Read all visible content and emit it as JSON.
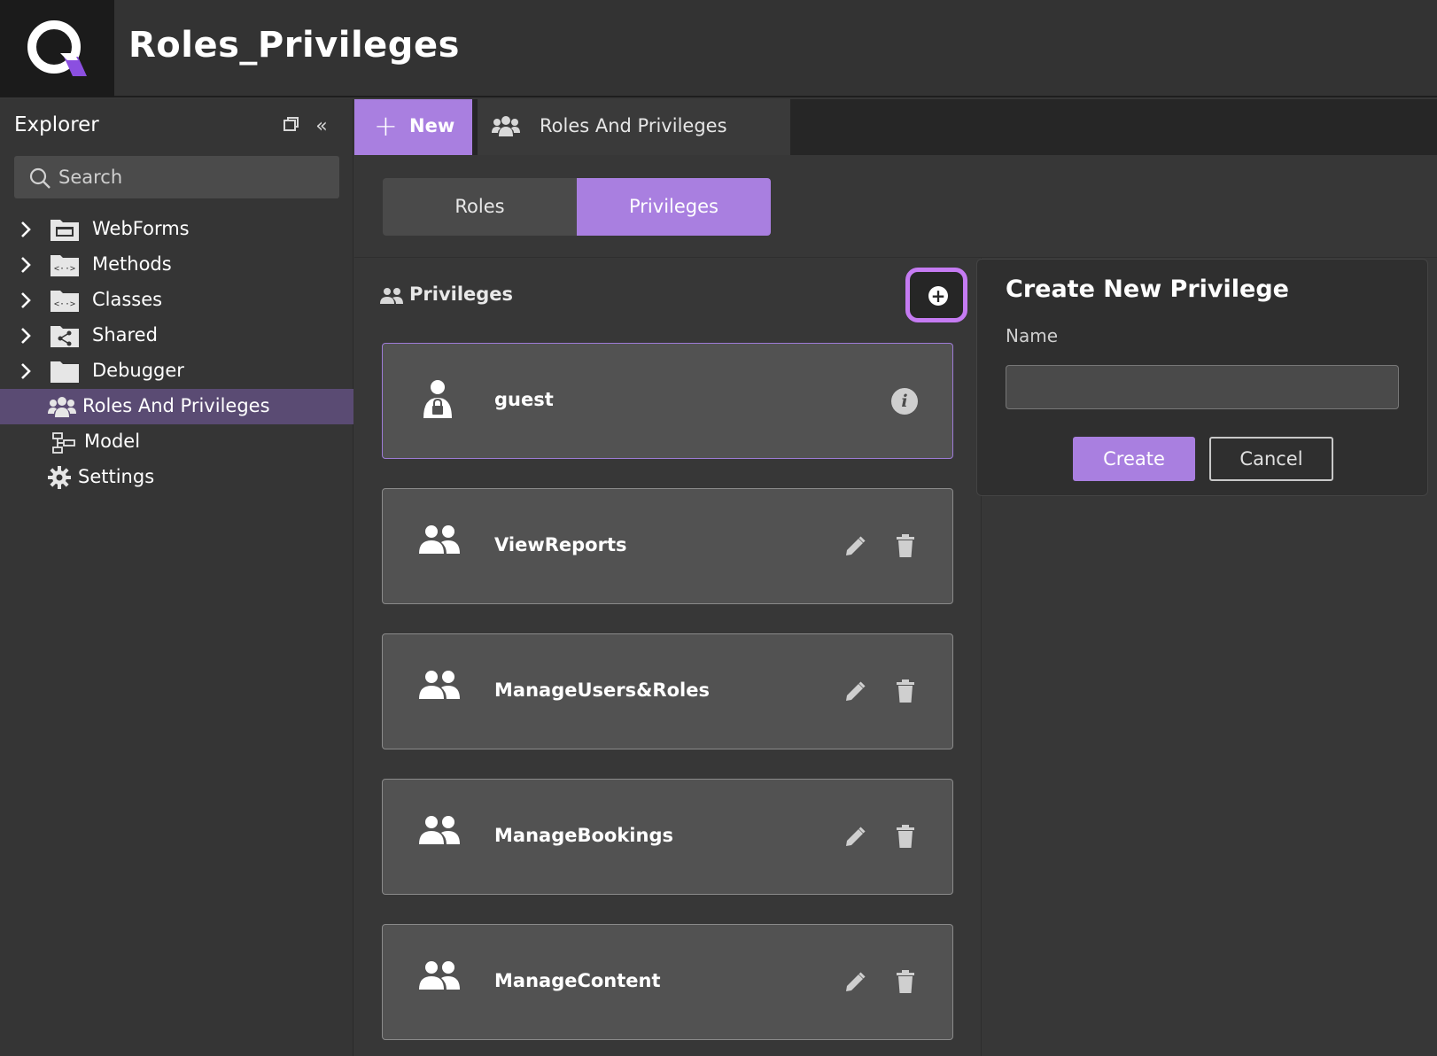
{
  "header": {
    "title": "Roles_Privileges",
    "logo_icon": "q-logo-icon",
    "accent": "#a97fe0"
  },
  "sidebar": {
    "title": "Explorer",
    "search_placeholder": "Search",
    "items": [
      {
        "label": "WebForms",
        "icon": "webform-folder-icon",
        "expandable": true
      },
      {
        "label": "Methods",
        "icon": "code-folder-icon",
        "expandable": true
      },
      {
        "label": "Classes",
        "icon": "code-folder-icon",
        "expandable": true
      },
      {
        "label": "Shared",
        "icon": "share-folder-icon",
        "expandable": true
      },
      {
        "label": "Debugger",
        "icon": "folder-icon",
        "expandable": true
      },
      {
        "label": "Roles And Privileges",
        "icon": "users-group-icon",
        "active": true
      },
      {
        "label": "Model",
        "icon": "model-icon"
      },
      {
        "label": "Settings",
        "icon": "gear-icon"
      }
    ]
  },
  "tabs": {
    "new_label": "New",
    "open_tab_label": "Roles And Privileges"
  },
  "segments": {
    "roles": "Roles",
    "privileges": "Privileges",
    "selected": "Privileges"
  },
  "privileges_section": {
    "title": "Privileges",
    "items": [
      {
        "name": "guest",
        "icon": "locked-user-icon",
        "action": "info"
      },
      {
        "name": "ViewReports",
        "icon": "people-icon",
        "action": "edit-delete"
      },
      {
        "name": "ManageUsers&Roles",
        "icon": "people-icon",
        "action": "edit-delete"
      },
      {
        "name": "ManageBookings",
        "icon": "people-icon",
        "action": "edit-delete"
      },
      {
        "name": "ManageContent",
        "icon": "people-icon",
        "action": "edit-delete"
      }
    ]
  },
  "popup": {
    "title": "Create New Privilege",
    "name_label": "Name",
    "name_value": "",
    "create_label": "Create",
    "cancel_label": "Cancel"
  }
}
